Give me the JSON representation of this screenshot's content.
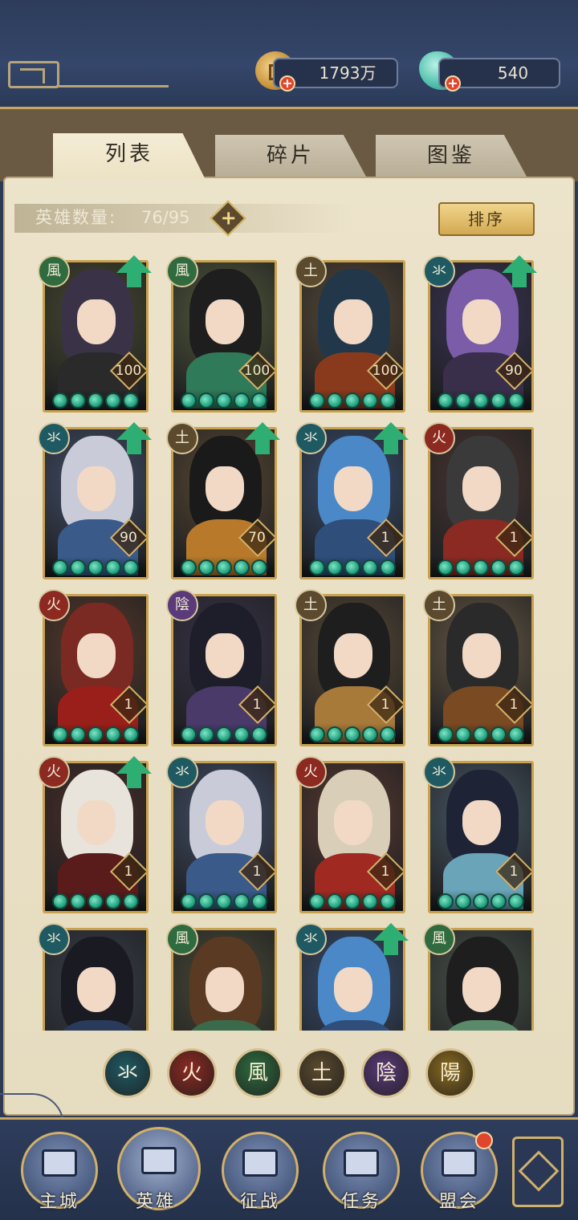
{
  "header": {
    "coins": "1793万",
    "jade": "540"
  },
  "tabs": [
    {
      "label": "列表",
      "active": true
    },
    {
      "label": "碎片",
      "active": false
    },
    {
      "label": "图鉴",
      "active": false
    }
  ],
  "hero_count": {
    "label": "英雄数量:",
    "value": "76/95"
  },
  "sort_label": "排序",
  "element_colors": {
    "water": "#1f5a63",
    "fire": "#8c2a22",
    "wind": "#2f6b3e",
    "earth": "#5b4a2e",
    "yin": "#5a3a78",
    "yang": "#8a6a1f"
  },
  "elements": {
    "water": "氺",
    "fire": "火",
    "wind": "風",
    "earth": "土",
    "yin": "陰",
    "yang": "陽"
  },
  "heroes": [
    {
      "element": "wind",
      "level": "100",
      "upgrade": true,
      "hair": "#3a3348",
      "outfit": "#2a2a2a",
      "bg": "#4a4a2e"
    },
    {
      "element": "wind",
      "level": "100",
      "upgrade": false,
      "hair": "#1e1e1e",
      "outfit": "#2f7a58",
      "bg": "#545a3a"
    },
    {
      "element": "earth",
      "level": "100",
      "upgrade": false,
      "hair": "#22384a",
      "outfit": "#8a3a1c",
      "bg": "#5a4a36"
    },
    {
      "element": "water",
      "level": "90",
      "upgrade": true,
      "hair": "#7a5ca8",
      "outfit": "#3a2f4a",
      "bg": "#3a3454"
    },
    {
      "element": "water",
      "level": "90",
      "upgrade": true,
      "hair": "#c9cbd8",
      "outfit": "#3a5a8a",
      "bg": "#44506a"
    },
    {
      "element": "earth",
      "level": "70",
      "upgrade": true,
      "hair": "#1a1a1a",
      "outfit": "#b87a2a",
      "bg": "#5a4830"
    },
    {
      "element": "water",
      "level": "1",
      "upgrade": true,
      "hair": "#4a88c8",
      "outfit": "#2f4e7a",
      "bg": "#3a5070"
    },
    {
      "element": "fire",
      "level": "1",
      "upgrade": false,
      "hair": "#3a3a3a",
      "outfit": "#8a2a22",
      "bg": "#4a3630"
    },
    {
      "element": "fire",
      "level": "1",
      "upgrade": false,
      "hair": "#7a2a22",
      "outfit": "#9a1f1a",
      "bg": "#5a3a2a"
    },
    {
      "element": "yin",
      "level": "1",
      "upgrade": false,
      "hair": "#1e1e2a",
      "outfit": "#4a3a6a",
      "bg": "#3a3448"
    },
    {
      "element": "earth",
      "level": "1",
      "upgrade": false,
      "hair": "#1e1e1e",
      "outfit": "#a87a3a",
      "bg": "#5a4a36"
    },
    {
      "element": "earth",
      "level": "1",
      "upgrade": false,
      "hair": "#2a2a2a",
      "outfit": "#7a4a22",
      "bg": "#6a5a44"
    },
    {
      "element": "fire",
      "level": "1",
      "upgrade": true,
      "hair": "#e8e4dc",
      "outfit": "#5a1c1a",
      "bg": "#4a2e28"
    },
    {
      "element": "water",
      "level": "1",
      "upgrade": false,
      "hair": "#c9cbd8",
      "outfit": "#3a5a8a",
      "bg": "#44506a"
    },
    {
      "element": "fire",
      "level": "1",
      "upgrade": false,
      "hair": "#d9cfb8",
      "outfit": "#a02a22",
      "bg": "#5a3a30"
    },
    {
      "element": "water",
      "level": "1",
      "upgrade": false,
      "hair": "#1e2436",
      "outfit": "#6aa4b8",
      "bg": "#4a5a66"
    },
    {
      "element": "water",
      "level": "",
      "upgrade": false,
      "hair": "#1a1a22",
      "outfit": "#2a3a5a",
      "bg": "#3a3e4a"
    },
    {
      "element": "wind",
      "level": "",
      "upgrade": false,
      "hair": "#5a3a22",
      "outfit": "#3a6a4a",
      "bg": "#4a4a36"
    },
    {
      "element": "water",
      "level": "",
      "upgrade": true,
      "hair": "#4a88c8",
      "outfit": "#2f4e7a",
      "bg": "#3a5070"
    },
    {
      "element": "wind",
      "level": "",
      "upgrade": false,
      "hair": "#1e1e1e",
      "outfit": "#5a8a6a",
      "bg": "#4a5448"
    }
  ],
  "filters": [
    "water",
    "fire",
    "wind",
    "earth",
    "yin",
    "yang"
  ],
  "nav": [
    {
      "label": "主城",
      "icon": "city-gate-icon",
      "active": false
    },
    {
      "label": "英雄",
      "icon": "hero-portrait-icon",
      "active": true
    },
    {
      "label": "征战",
      "icon": "battle-icon",
      "active": false
    },
    {
      "label": "任务",
      "icon": "scroll-icon",
      "active": false
    },
    {
      "label": "盟会",
      "icon": "alliance-hall-icon",
      "active": false
    }
  ]
}
